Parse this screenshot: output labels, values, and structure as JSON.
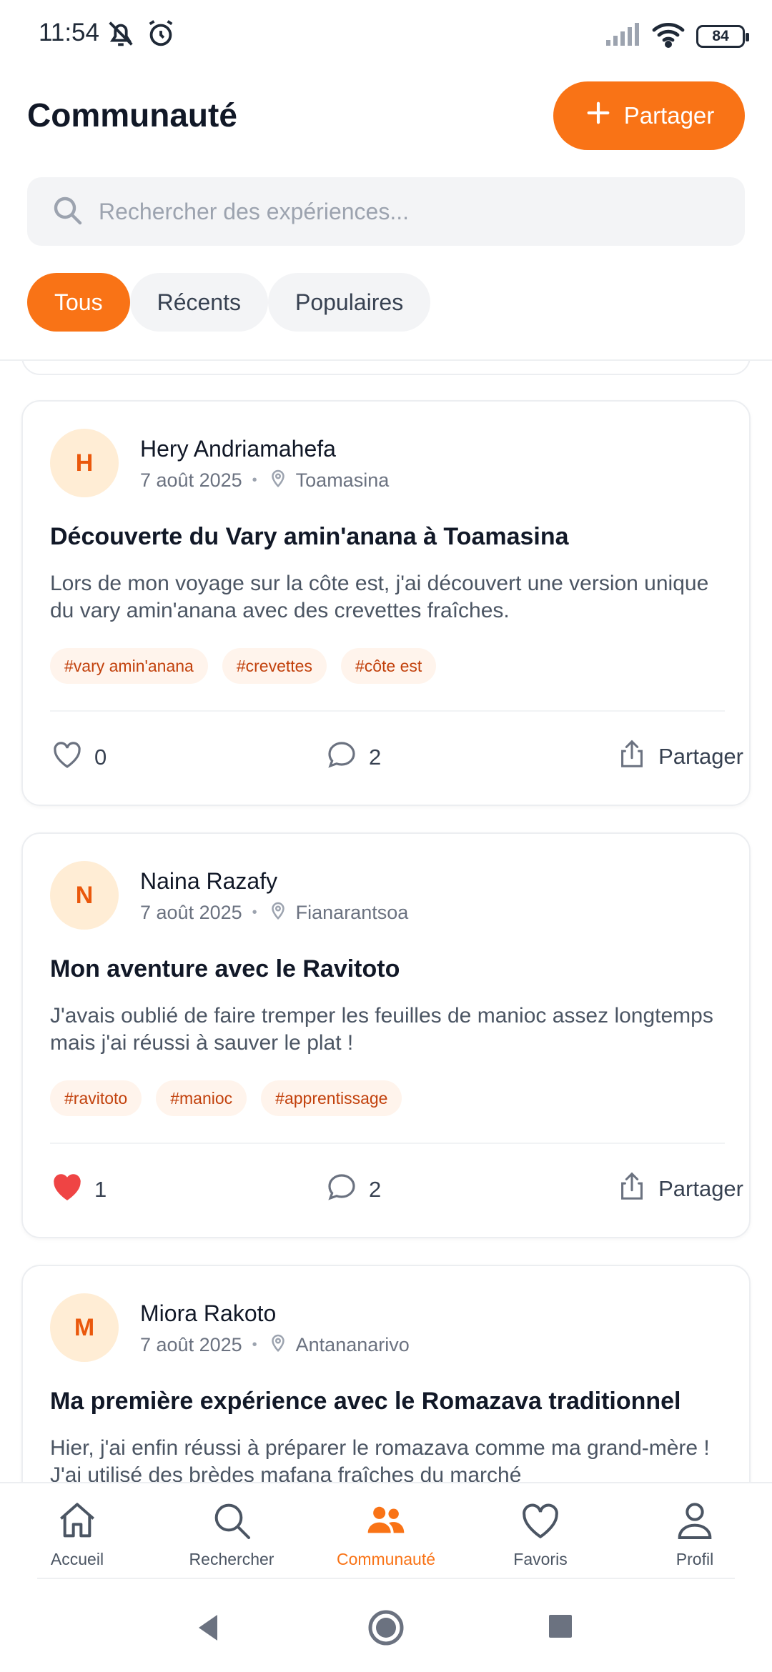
{
  "status": {
    "time": "11:54",
    "battery": "84"
  },
  "header": {
    "title": "Communauté",
    "share_label": "Partager"
  },
  "search": {
    "placeholder": "Rechercher des expériences..."
  },
  "filters": [
    {
      "label": "Tous",
      "active": true
    },
    {
      "label": "Récents",
      "active": false
    },
    {
      "label": "Populaires",
      "active": false
    }
  ],
  "posts": [
    {
      "initial": "H",
      "author": "Hery Andriamahefa",
      "date": "7 août 2025",
      "location": "Toamasina",
      "title": "Découverte du Vary amin'anana à Toamasina",
      "body": "Lors de mon voyage sur la côte est, j'ai découvert une version unique du vary amin'anana avec des crevettes fraîches.",
      "tags": [
        "#vary amin'anana",
        "#crevettes",
        "#côte est"
      ],
      "likes": "0",
      "liked": false,
      "comments": "2",
      "share_label": "Partager"
    },
    {
      "initial": "N",
      "author": "Naina Razafy",
      "date": "7 août 2025",
      "location": "Fianarantsoa",
      "title": "Mon aventure avec le Ravitoto",
      "body": "J'avais oublié de faire tremper les feuilles de manioc assez longtemps mais j'ai réussi à sauver le plat !",
      "tags": [
        "#ravitoto",
        "#manioc",
        "#apprentissage"
      ],
      "likes": "1",
      "liked": true,
      "comments": "2",
      "share_label": "Partager"
    },
    {
      "initial": "M",
      "author": "Miora Rakoto",
      "date": "7 août 2025",
      "location": "Antananarivo",
      "title": "Ma première expérience avec le Romazava traditionnel",
      "body": "Hier, j'ai enfin réussi à préparer le romazava comme ma grand-mère ! J'ai utilisé des brèdes mafana fraîches du marché"
    }
  ],
  "bottom_nav": [
    {
      "label": "Accueil",
      "icon": "home-icon"
    },
    {
      "label": "Rechercher",
      "icon": "search-icon"
    },
    {
      "label": "Communauté",
      "icon": "people-icon",
      "active": true
    },
    {
      "label": "Favoris",
      "icon": "heart-icon"
    },
    {
      "label": "Profil",
      "icon": "profile-icon"
    }
  ],
  "colors": {
    "accent": "#f97316",
    "like": "#ef4444"
  }
}
